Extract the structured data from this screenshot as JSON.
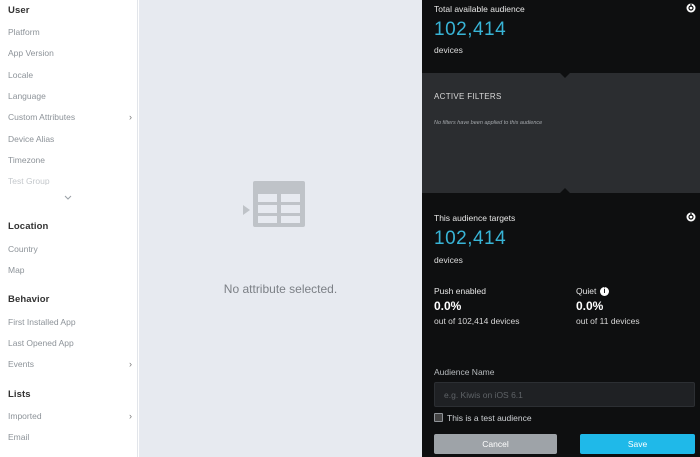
{
  "sidebar": {
    "user": {
      "title": "User",
      "items": [
        {
          "label": "Platform"
        },
        {
          "label": "App Version"
        },
        {
          "label": "Locale"
        },
        {
          "label": "Language"
        },
        {
          "label": "Custom Attributes",
          "has_submenu": true
        },
        {
          "label": "Device Alias"
        },
        {
          "label": "Timezone"
        },
        {
          "label": "Test Group",
          "faded": true
        }
      ]
    },
    "location": {
      "title": "Location",
      "items": [
        {
          "label": "Country"
        },
        {
          "label": "Map"
        }
      ]
    },
    "behavior": {
      "title": "Behavior",
      "items": [
        {
          "label": "First Installed App"
        },
        {
          "label": "Last Opened App"
        },
        {
          "label": "Events",
          "has_submenu": true
        }
      ]
    },
    "lists": {
      "title": "Lists",
      "items": [
        {
          "label": "Imported",
          "has_submenu": true
        },
        {
          "label": "Email"
        }
      ]
    }
  },
  "center": {
    "empty_message": "No attribute selected.",
    "icon": "table-icon"
  },
  "panel": {
    "total": {
      "label": "Total available audience",
      "value": "102,414",
      "unit": "devices"
    },
    "filters": {
      "title": "ACTIVE FILTERS",
      "empty": "No filters have been applied to this audience"
    },
    "targets": {
      "label": "This audience targets",
      "value": "102,414",
      "unit": "devices"
    },
    "push": {
      "label": "Push enabled",
      "value": "0.0%",
      "sub": "out of 102,414 devices"
    },
    "quiet": {
      "label": "Quiet",
      "value": "0.0%",
      "sub": "out of 11 devices"
    },
    "audience_name": {
      "label": "Audience Name",
      "placeholder": "e.g. Kiwis on iOS 6.1",
      "value": ""
    },
    "test_audience_label": "This is a test audience",
    "cancel_label": "Cancel",
    "save_label": "Save"
  },
  "colors": {
    "accent_blue": "#38b4d6",
    "save_button": "#1fb9e9",
    "cancel_button": "#9ea3a8",
    "panel_dark": "#0e0f10",
    "filters_bg": "#2b2d30",
    "center_bg": "#e7eaf0"
  }
}
